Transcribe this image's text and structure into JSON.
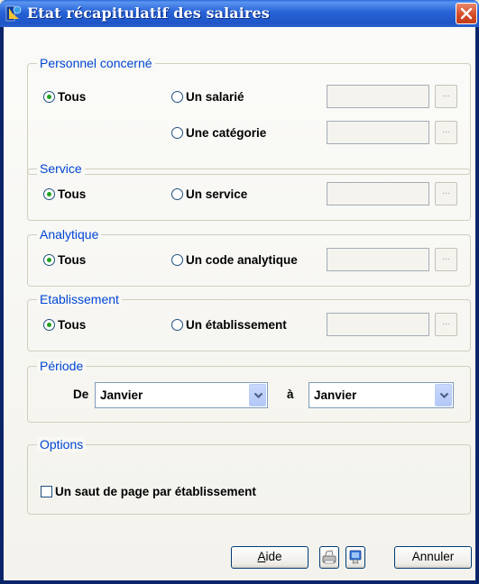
{
  "window": {
    "title": "Etat récapitulatif des salaires",
    "icons": {
      "app": "app-logo-icon",
      "close": "close-icon"
    }
  },
  "groups": {
    "personnel": {
      "legend": "Personnel concerné",
      "options": [
        "Tous",
        "Un salarié",
        "Une catégorie"
      ],
      "selected": "Tous"
    },
    "service": {
      "legend": "Service",
      "options": [
        "Tous",
        "Un service"
      ],
      "selected": "Tous"
    },
    "analytique": {
      "legend": "Analytique",
      "options": [
        "Tous",
        "Un code analytique"
      ],
      "selected": "Tous"
    },
    "etablissement": {
      "legend": "Etablissement",
      "options": [
        "Tous",
        "Un établissement"
      ],
      "selected": "Tous"
    },
    "periode": {
      "legend": "Période",
      "from_label": "De",
      "from_value": "Janvier",
      "to_label": "à",
      "to_value": "Janvier"
    },
    "options": {
      "legend": "Options",
      "page_break_label": "Un saut de page par établissement",
      "page_break_checked": false
    }
  },
  "browse_button_label": "...",
  "buttons": {
    "help": "Aide",
    "print_icon": "printer-icon",
    "preview_icon": "preview-icon",
    "cancel": "Annuler"
  },
  "colors": {
    "titlebar": "#2762d6",
    "legend": "#0046d5",
    "radio_dot": "#21a121",
    "close": "#d34a25"
  }
}
